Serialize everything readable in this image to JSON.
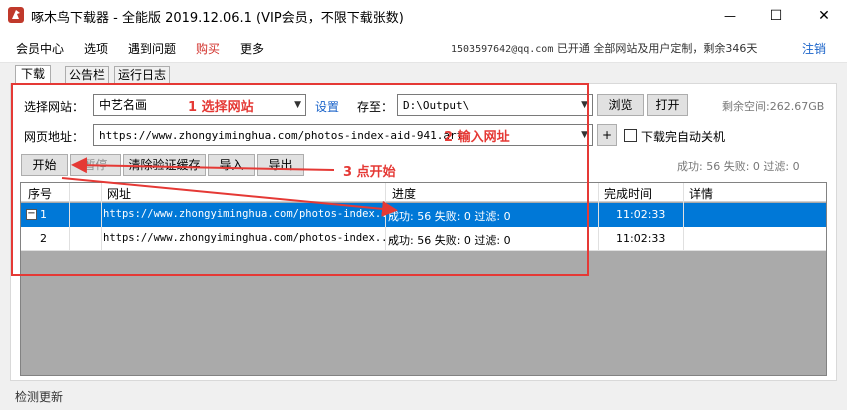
{
  "window": {
    "title": "啄木鸟下载器 - 全能版 2019.12.06.1  (VIP会员，不限下载张数)",
    "minimize": "—",
    "maximize": "☐",
    "close": "✕"
  },
  "menu": {
    "items": [
      "会员中心",
      "选项",
      "遇到问题",
      "购买",
      "更多"
    ],
    "highlight_color": "#d2312b",
    "account_email": "1503597642@qq.com",
    "account_status": "已开通  全部网站及用户定制，剩余346天",
    "logout": "注销"
  },
  "tabs": [
    "下载",
    "公告栏",
    "运行日志"
  ],
  "form": {
    "site_label": "选择网站：",
    "site_value": "中艺名画",
    "settings_link": "设置",
    "save_label": "存至：",
    "save_path": "D:\\Output\\",
    "browse": "浏览",
    "open": "打开",
    "free_space": "剩余空间:262.67GB",
    "url_label": "网页地址：",
    "url_value": "https://www.zhongyiminghua.com/photos-index-aid-941.art",
    "add_button": "+",
    "shutdown_label": "下载完自动关机",
    "start": "开始",
    "pause": "暂停",
    "clear_cache": "清除验证缓存",
    "import": "导入",
    "export": "导出",
    "summary": "成功: 56 失败: 0 过滤: 0"
  },
  "table": {
    "columns": [
      "序号",
      "网址",
      "进度",
      "完成时间",
      "详情"
    ],
    "rows": [
      {
        "index": "1",
        "url": "https://www.zhongyiminghua.com/photos-index...",
        "progress": "成功: 56 失败: 0 过滤: 0",
        "time": "11:02:33",
        "detail": "",
        "selected": true,
        "expand": "−"
      },
      {
        "index": "2",
        "url": "https://www.zhongyiminghua.com/photos-index...",
        "progress": "成功: 56 失败: 0 过滤: 0",
        "time": "11:02:33",
        "detail": "",
        "selected": false
      }
    ]
  },
  "annotations": {
    "step1": "1 选择网站",
    "step2": "2 输入网址",
    "step3": "3 点开始",
    "color": "#e53935"
  },
  "status": {
    "check_update": "检测更新"
  }
}
